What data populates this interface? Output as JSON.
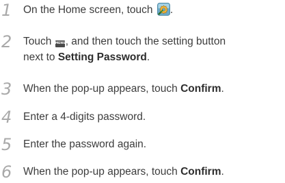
{
  "steps": [
    {
      "number": "1",
      "text_before": "On the Home screen, touch",
      "icon": "settings-app-icon",
      "text_after": "."
    },
    {
      "number": "2",
      "text_touch": "Touch",
      "menu_key_label": "MENU",
      "text_after_key": ", and then touch the setting button",
      "line2_text": "next to",
      "line2_bold": "Setting Password",
      "line2_end": "."
    },
    {
      "number": "3",
      "text": "When the pop-up appears, touch",
      "bold": "Confirm",
      "end": "."
    },
    {
      "number": "4",
      "text": "Enter a 4-digits password."
    },
    {
      "number": "5",
      "text": "Enter the password again."
    },
    {
      "number": "6",
      "text": "When the pop-up appears, touch",
      "bold": "Confirm",
      "end": "."
    }
  ]
}
